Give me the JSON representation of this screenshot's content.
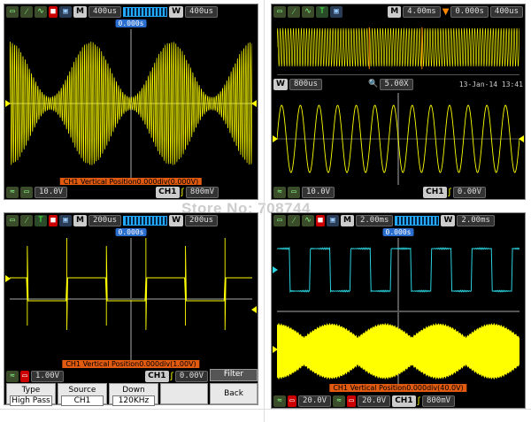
{
  "watermark": "Store No: 708744",
  "p1": {
    "top": {
      "m": "M",
      "time": "400us",
      "w": "W",
      "wtime": "400us",
      "pos": "0.000s"
    },
    "message": "CH1 Vertical Position0.000div(0.000V)",
    "bottom": {
      "ch1_scale": "10.0V",
      "trig_src": "CH1",
      "trig_level": "800mV"
    }
  },
  "p2": {
    "top": {
      "m": "M",
      "time": "4.00ms",
      "trig_pos": "0.000s",
      "wtime": "400us"
    },
    "zoom": {
      "w": "W",
      "time": "800us",
      "zoom": "5.00X",
      "date": "13-Jan-14 13:41"
    },
    "bottom": {
      "ch1_scale": "10.0V",
      "trig_src": "CH1",
      "trig_level": "0.00V"
    }
  },
  "p3": {
    "top": {
      "m": "M",
      "time": "200us",
      "w": "W",
      "wtime": "200us",
      "pos": "0.000s"
    },
    "message": "CH1 Vertical Position0.000div(1.00V)",
    "bottom": {
      "ch1_scale": "1.00V",
      "trig_src": "CH1",
      "trig_level": "0.00V"
    },
    "menu": {
      "title": "Filter",
      "type_label": "Type",
      "type_value": "High Pass",
      "source_label": "Source",
      "source_value": "CH1",
      "down_label": "Down",
      "down_value": "120KHz",
      "back": "Back"
    }
  },
  "p4": {
    "top": {
      "m": "M",
      "time": "2.00ms",
      "w": "W",
      "wtime": "2.00ms",
      "pos": "0.000s"
    },
    "message": "CH1 Vertical Position0.000div(40.0V)",
    "bottom": {
      "ch1_scale": "20.0V",
      "ch2_scale": "20.0V",
      "trig_src": "CH1",
      "trig_level": "800mV"
    }
  },
  "colors": {
    "ch1": "#ffff00",
    "ch2": "#2ad4e0",
    "accent": "#2a6ed0",
    "warn": "#e05a10"
  }
}
